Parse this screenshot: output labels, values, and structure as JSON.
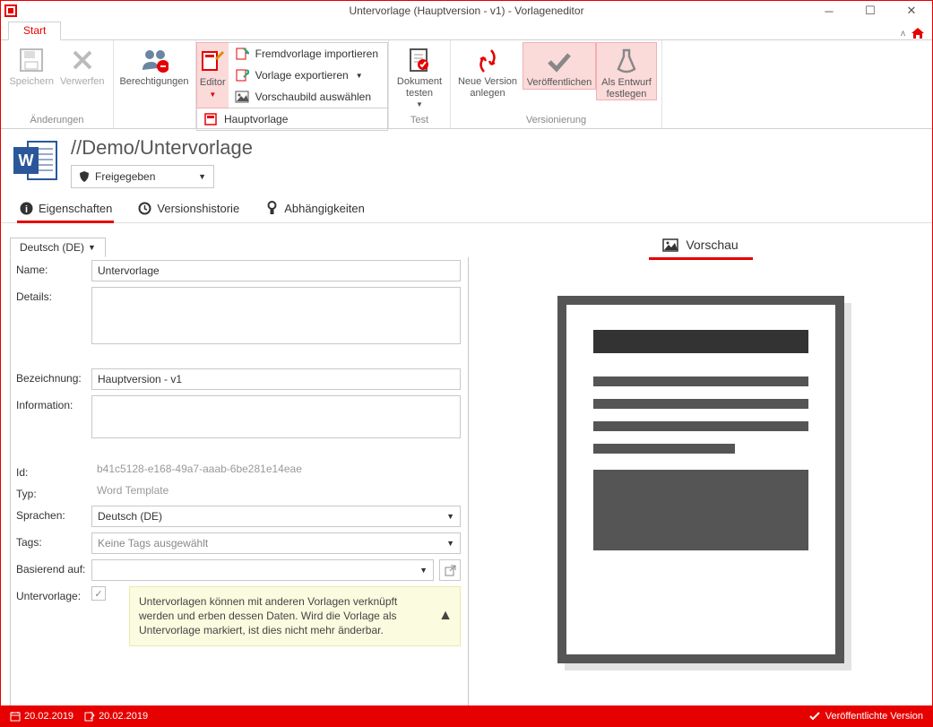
{
  "window": {
    "title": "Untervorlage (Hauptversion - v1) - Vorlageneditor"
  },
  "tabs": {
    "start": "Start"
  },
  "ribbon": {
    "changes": {
      "group": "Änderungen",
      "save": "Speichern",
      "discard": "Verwerfen"
    },
    "permissions": {
      "label": "Berechtigungen"
    },
    "editor": {
      "label": "Editor",
      "import_foreign": "Fremdvorlage importieren",
      "export_template": "Vorlage exportieren",
      "select_thumbnail": "Vorschaubild auswählen",
      "main_template": "Hauptvorlage"
    },
    "test": {
      "group": "Test",
      "doc_test": "Dokument testen"
    },
    "versioning": {
      "group": "Versionierung",
      "new_version": "Neue Version anlegen",
      "publish": "Veröffentlichen",
      "draft": "Als Entwurf festlegen"
    }
  },
  "doc": {
    "path": "//Demo/Untervorlage",
    "status": "Freigegeben"
  },
  "navtabs": {
    "properties": "Eigenschaften",
    "history": "Versionshistorie",
    "dependencies": "Abhängigkeiten"
  },
  "form": {
    "language_tab": "Deutsch (DE)",
    "labels": {
      "name": "Name:",
      "details": "Details:",
      "designation": "Bezeichnung:",
      "information": "Information:",
      "id": "Id:",
      "type": "Typ:",
      "languages": "Sprachen:",
      "tags": "Tags:",
      "based_on": "Basierend auf:",
      "subtemplate": "Untervorlage:"
    },
    "values": {
      "name": "Untervorlage",
      "details": "",
      "designation": "Hauptversion - v1",
      "information": "",
      "id": "b41c5128-e168-49a7-aaab-6be281e14eae",
      "type": "Word Template",
      "languages": "Deutsch (DE)",
      "tags": "Keine Tags ausgewählt",
      "based_on": ""
    },
    "subtemplate_info": "Untervorlagen können mit anderen Vorlagen verknüpft werden und erben dessen Daten. Wird die Vorlage als Untervorlage markiert, ist dies nicht mehr änderbar."
  },
  "preview": {
    "title": "Vorschau"
  },
  "status": {
    "created": "20.02.2019",
    "modified": "20.02.2019",
    "published_version": "Veröffentlichte Version"
  }
}
